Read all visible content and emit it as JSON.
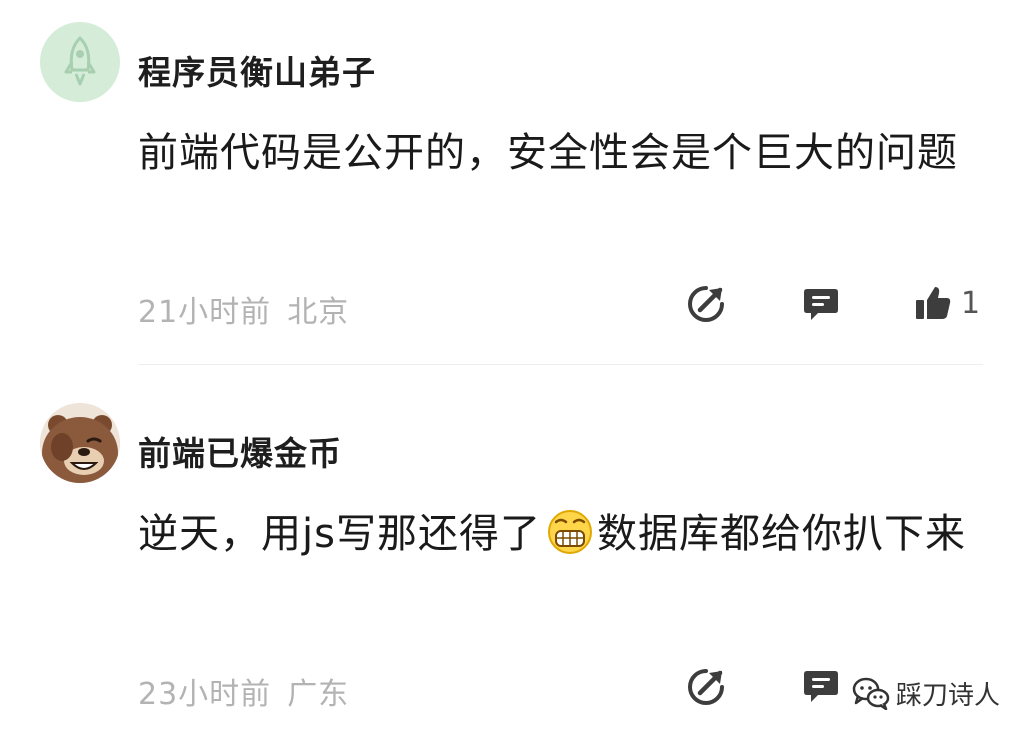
{
  "comments": [
    {
      "avatar_icon": "rocket-icon",
      "username": "程序员衡山弟子",
      "text": "前端代码是公开的，安全性会是个巨大的问题",
      "time": "21小时前",
      "location": "北京",
      "likes": "1"
    },
    {
      "avatar_icon": "bear-avatar",
      "username": "前端已爆金币",
      "text_before_emoji": "逆天，用js写那还得了",
      "emoji": "grin-emoji",
      "text_after_emoji": "数据库都给你扒下来",
      "time": "23小时前",
      "location": "广东"
    }
  ],
  "icons": {
    "share": "share-icon",
    "reply": "reply-icon",
    "like": "thumbs-up-icon"
  },
  "colors": {
    "icon_dark": "#3d3d3d",
    "meta_gray": "#b3b3b3",
    "avatar_green": "#d5ecd9",
    "rocket_green": "#a7cfb0"
  },
  "watermark": {
    "text": "踩刀诗人",
    "icon": "wechat-icon"
  }
}
